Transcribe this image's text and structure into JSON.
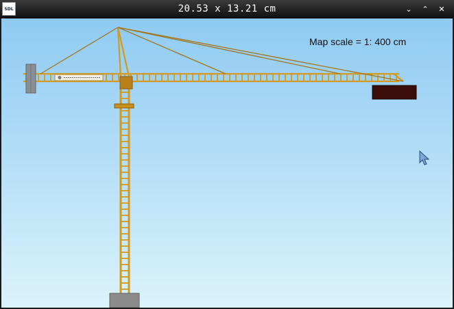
{
  "window": {
    "title": "20.53 x 13.21 cm",
    "app_icon_text": "SDL",
    "controls": {
      "minimize": "⌄",
      "maximize": "⌃",
      "close": "✕"
    }
  },
  "scene": {
    "scale_label": "Map scale = 1: 400 cm",
    "sky_color": "#a8d8f5",
    "crane_color": "#d49a1e",
    "counterweight_color": "#8a8f96",
    "load_color": "#3a0f0a",
    "base_color": "#8a8a8a"
  }
}
